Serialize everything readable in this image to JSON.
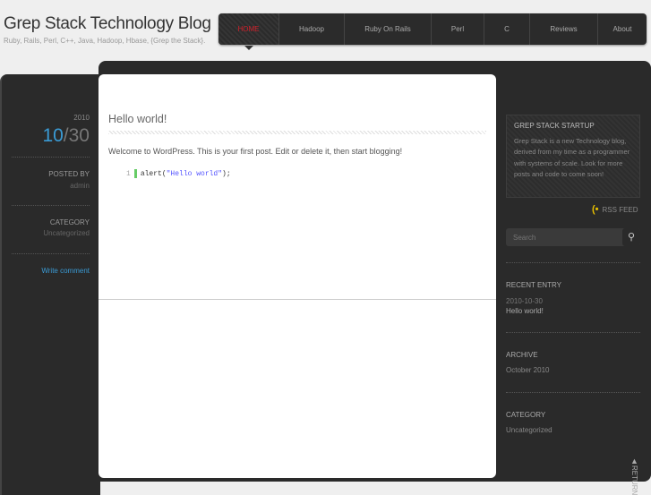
{
  "site": {
    "title": "Grep Stack Technology Blog",
    "tagline": "Ruby, Rails, Perl, C++, Java, Hadoop, Hbase, {Grep the Stack}."
  },
  "nav": [
    {
      "label": "HOME"
    },
    {
      "label": "Hadoop"
    },
    {
      "label": "Ruby On Rails"
    },
    {
      "label": "Perl"
    },
    {
      "label": "C"
    },
    {
      "label": "Reviews"
    },
    {
      "label": "About"
    }
  ],
  "post": {
    "year": "2010",
    "month": "10",
    "day": "/30",
    "posted_by_label": "POSTED BY",
    "author": "admin",
    "category_label": "CATEGORY",
    "category": "Uncategorized",
    "write_comment": "Write comment",
    "title": "Hello world!",
    "body": "Welcome to WordPress. This is your first post. Edit or delete it, then start blogging!",
    "code_line_no": "1",
    "code_fn": "alert(",
    "code_str": "\"Hello world\"",
    "code_end": ");"
  },
  "sidebar": {
    "startup_title": "GREP STACK STARTUP",
    "startup_text": "Grep Stack is a new Technology blog, derived from my time as a programmer with systems of scale. Look for more posts and code to come soon!",
    "rss": "RSS FEED",
    "search_placeholder": "Search",
    "recent_title": "RECENT ENTRY",
    "recent_date": "2010-10-30",
    "recent_post": "Hello world!",
    "archive_title": "ARCHIVE",
    "archive_item": "October 2010",
    "category_title": "CATEGORY",
    "category_item": "Uncategorized",
    "return": "RETURN"
  },
  "colors": {
    "accent": "#3a9bd5",
    "active_nav": "#d0202b",
    "rss": "#e8c000"
  }
}
